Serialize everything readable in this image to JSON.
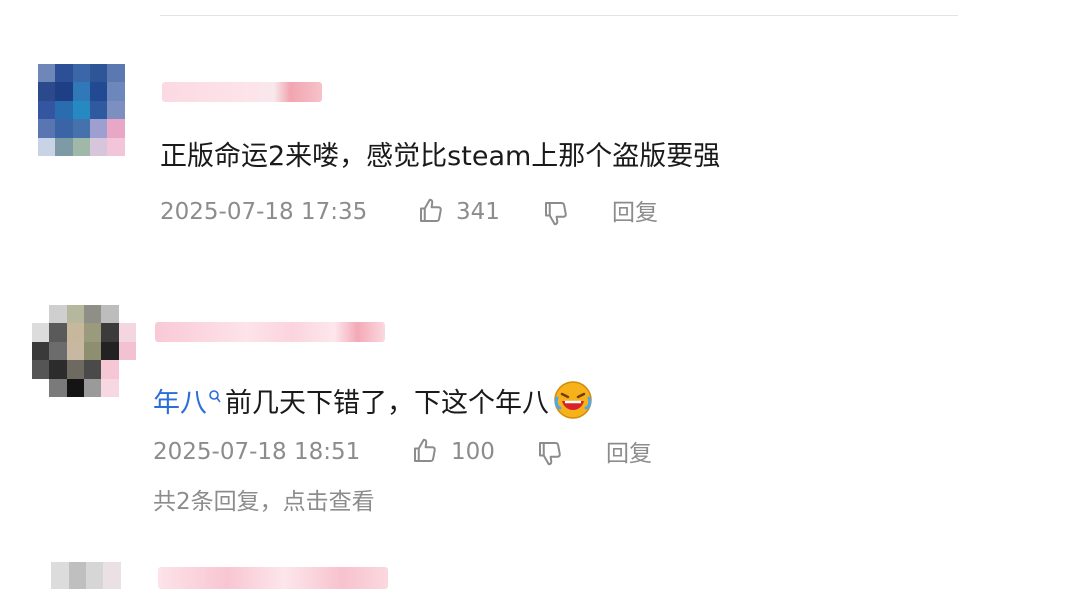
{
  "comments": [
    {
      "text": "正版命运2来喽，感觉比steam上那个盗版要强",
      "timestamp": "2025-07-18 17:35",
      "like_count": "341",
      "reply_label": "回复",
      "icons": [
        "thumbs-up-icon",
        "thumbs-down-icon"
      ]
    },
    {
      "mention": "年八",
      "mention_icon": "search-icon",
      "text": "前几天下错了，下这个年八",
      "emoji": "laughing-crying-emoji",
      "timestamp": "2025-07-18 18:51",
      "like_count": "100",
      "reply_label": "回复",
      "replies_link": "共2条回复，点击查看",
      "icons": [
        "thumbs-up-icon",
        "thumbs-down-icon"
      ]
    }
  ]
}
